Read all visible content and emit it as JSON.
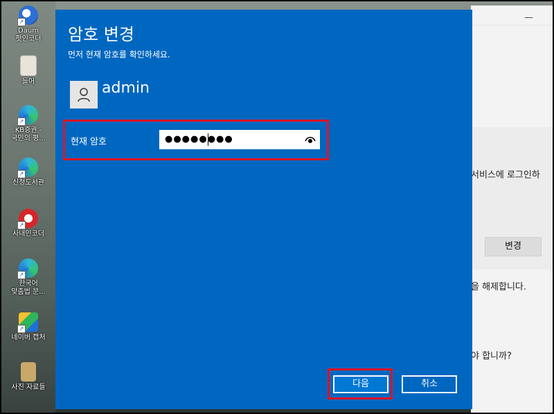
{
  "dialog": {
    "title": "암호 변경",
    "subtitle": "먼저 현재 암호를 확인하세요.",
    "username": "admin",
    "password_label": "현재 암호",
    "password_value": "●●●●●●●●",
    "next_button": "다음",
    "cancel_button": "취소",
    "avatar_icon": "user-icon",
    "reveal_icon": "eye-icon",
    "accent_color": "#0067c0",
    "highlight_color": "#e81123"
  },
  "desktop": {
    "icons": [
      {
        "label": "Daum\n팟인코더",
        "icon": "daum-potencoder-icon"
      },
      {
        "label": "들어",
        "icon": "document-icon"
      },
      {
        "label": "KB증권 -\n국민의 평...",
        "icon": "edge-icon"
      },
      {
        "label": "신청도서관",
        "icon": "edge-icon"
      },
      {
        "label": "사내인코더",
        "icon": "encoder-icon"
      },
      {
        "label": "한국어\n맞춤법 문...",
        "icon": "edge-icon"
      },
      {
        "label": "네이버 캡처",
        "icon": "naver-capture-icon"
      },
      {
        "label": "사진 자료들",
        "icon": "folder-icon"
      }
    ]
  },
  "background_window": {
    "text_line1": "서비스에 로그인하",
    "change_button": "변경",
    "text_line2": "을 해제합니다.",
    "text_line3": "야 합니까?"
  }
}
